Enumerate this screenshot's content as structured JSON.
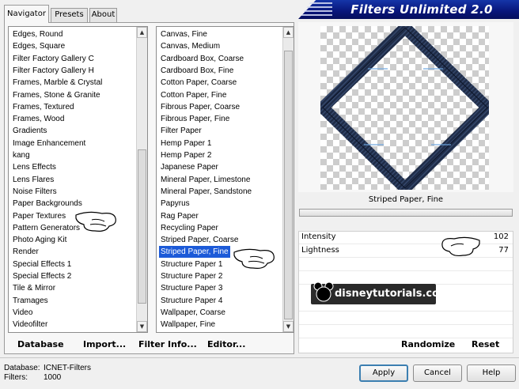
{
  "banner": {
    "title": "Filters Unlimited 2.0"
  },
  "tabs": [
    {
      "label": "Navigator"
    },
    {
      "label": "Presets"
    },
    {
      "label": "About"
    }
  ],
  "categories": {
    "items": [
      "Edges, Round",
      "Edges, Square",
      "Filter Factory Gallery C",
      "Filter Factory Gallery H",
      "Frames, Marble & Crystal",
      "Frames, Stone & Granite",
      "Frames, Textured",
      "Frames, Wood",
      "Gradients",
      "Image Enhancement",
      "kang",
      "Lens Effects",
      "Lens Flares",
      "Noise Filters",
      "Paper Backgrounds",
      "Paper Textures",
      "Pattern Generators",
      "Photo Aging Kit",
      "Render",
      "Special Effects 1",
      "Special Effects 2",
      "Tile & Mirror",
      "Tramages",
      "Video",
      "Videofilter"
    ]
  },
  "filters": {
    "items": [
      "Canvas, Fine",
      "Canvas, Medium",
      "Cardboard Box, Coarse",
      "Cardboard Box, Fine",
      "Cotton Paper, Coarse",
      "Cotton Paper, Fine",
      "Fibrous Paper, Coarse",
      "Fibrous Paper, Fine",
      "Filter Paper",
      "Hemp Paper 1",
      "Hemp Paper 2",
      "Japanese Paper",
      "Mineral Paper, Limestone",
      "Mineral Paper, Sandstone",
      "Papyrus",
      "Rag Paper",
      "Recycling Paper",
      "Striped Paper, Coarse",
      "Striped Paper, Fine",
      "Structure Paper 1",
      "Structure Paper 2",
      "Structure Paper 3",
      "Structure Paper 4",
      "Wallpaper, Coarse",
      "Wallpaper, Fine"
    ],
    "selected": "Striped Paper, Fine"
  },
  "preview": {
    "filter_name": "Striped Paper, Fine"
  },
  "params": [
    {
      "label": "Intensity",
      "value": "102"
    },
    {
      "label": "Lightness",
      "value": "77"
    }
  ],
  "toolbar": {
    "database": "Database",
    "import": "Import...",
    "filter_info": "Filter Info...",
    "editor": "Editor...",
    "randomize": "Randomize",
    "reset": "Reset"
  },
  "status": {
    "database_label": "Database:",
    "database_value": "ICNET-Filters",
    "filters_label": "Filters:",
    "filters_value": "1000"
  },
  "buttons": {
    "apply": "Apply",
    "cancel": "Cancel",
    "help": "Help"
  },
  "watermark": {
    "text": "disneytutorials.com"
  },
  "colors": {
    "selection": "#1c5ad8",
    "banner": "#0a1a86",
    "frame": "#1e2a44"
  }
}
